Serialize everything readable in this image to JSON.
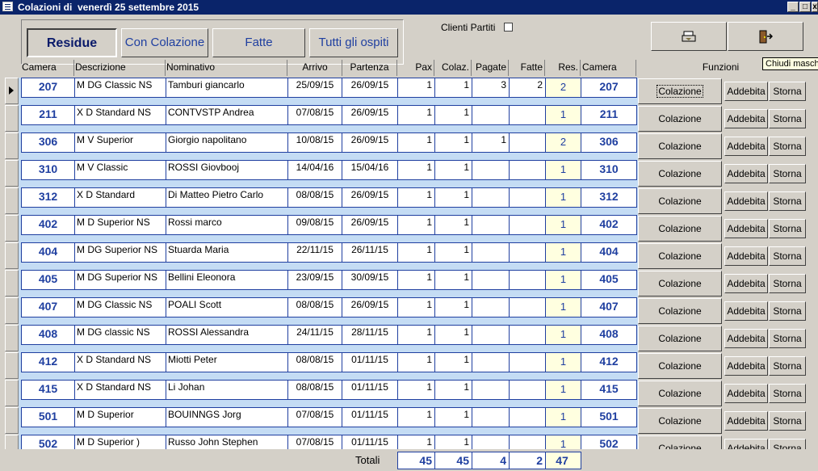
{
  "window": {
    "title": "Colazioni di  venerdì 25 settembre 2015",
    "min": "_",
    "max": "□",
    "close": "x"
  },
  "tabs": [
    {
      "label": "Residue",
      "active": true
    },
    {
      "label": "Con Colazione",
      "active": false
    },
    {
      "label": "Fatte",
      "active": false
    },
    {
      "label": "Tutti gli ospiti",
      "active": false
    }
  ],
  "filter": {
    "label": "Clienti Partiti",
    "checked": false
  },
  "toolbar": {
    "print_icon": "print-icon",
    "exit_icon": "exit-door-icon",
    "tooltip": "Chiudi maschera"
  },
  "columns": {
    "camera": "Camera",
    "descrizione": "Descrizione",
    "nominativo": "Nominativo",
    "arrivo": "Arrivo",
    "partenza": "Partenza",
    "pax": "Pax",
    "colaz": "Colaz.",
    "pagate": "Pagate",
    "fatte": "Fatte",
    "res": "Res.",
    "camera2": "Camera",
    "funzioni": "Funzioni"
  },
  "buttons": {
    "colazione": "Colazione",
    "addebita": "Addebita",
    "storna": "Storna"
  },
  "rows": [
    {
      "camera": "207",
      "descrizione": "M DG Classic NS",
      "nominativo": "Tamburi giancarlo",
      "arrivo": "25/09/15",
      "partenza": "26/09/15",
      "pax": "1",
      "colaz": "1",
      "pagate": "3",
      "fatte": "2",
      "res": "2"
    },
    {
      "camera": "211",
      "descrizione": "X D Standard NS",
      "nominativo": "CONTVSTP Andrea",
      "arrivo": "07/08/15",
      "partenza": "26/09/15",
      "pax": "1",
      "colaz": "1",
      "pagate": "",
      "fatte": "",
      "res": "1"
    },
    {
      "camera": "306",
      "descrizione": "M V Superior",
      "nominativo": "Giorgio napolitano",
      "arrivo": "10/08/15",
      "partenza": "26/09/15",
      "pax": "1",
      "colaz": "1",
      "pagate": "1",
      "fatte": "",
      "res": "2"
    },
    {
      "camera": "310",
      "descrizione": "M V Classic",
      "nominativo": "ROSSI Giovbooj",
      "arrivo": "14/04/16",
      "partenza": "15/04/16",
      "pax": "1",
      "colaz": "1",
      "pagate": "",
      "fatte": "",
      "res": "1"
    },
    {
      "camera": "312",
      "descrizione": "X D Standard",
      "nominativo": "Di Matteo Pietro Carlo",
      "arrivo": "08/08/15",
      "partenza": "26/09/15",
      "pax": "1",
      "colaz": "1",
      "pagate": "",
      "fatte": "",
      "res": "1"
    },
    {
      "camera": "402",
      "descrizione": "M D Superior NS",
      "nominativo": "Rossi marco",
      "arrivo": "09/08/15",
      "partenza": "26/09/15",
      "pax": "1",
      "colaz": "1",
      "pagate": "",
      "fatte": "",
      "res": "1"
    },
    {
      "camera": "404",
      "descrizione": "M DG Superior NS",
      "nominativo": "Stuarda Maria",
      "arrivo": "22/11/15",
      "partenza": "26/11/15",
      "pax": "1",
      "colaz": "1",
      "pagate": "",
      "fatte": "",
      "res": "1"
    },
    {
      "camera": "405",
      "descrizione": "M DG Superior NS",
      "nominativo": "Bellini Eleonora",
      "arrivo": "23/09/15",
      "partenza": "30/09/15",
      "pax": "1",
      "colaz": "1",
      "pagate": "",
      "fatte": "",
      "res": "1"
    },
    {
      "camera": "407",
      "descrizione": "M DG Classic NS",
      "nominativo": "POALI Scott",
      "arrivo": "08/08/15",
      "partenza": "26/09/15",
      "pax": "1",
      "colaz": "1",
      "pagate": "",
      "fatte": "",
      "res": "1"
    },
    {
      "camera": "408",
      "descrizione": "M DG classic NS",
      "nominativo": "ROSSI Alessandra",
      "arrivo": "24/11/15",
      "partenza": "28/11/15",
      "pax": "1",
      "colaz": "1",
      "pagate": "",
      "fatte": "",
      "res": "1"
    },
    {
      "camera": "412",
      "descrizione": "X D Standard NS",
      "nominativo": "Miotti Peter",
      "arrivo": "08/08/15",
      "partenza": "01/11/15",
      "pax": "1",
      "colaz": "1",
      "pagate": "",
      "fatte": "",
      "res": "1"
    },
    {
      "camera": "415",
      "descrizione": "X D Standard NS",
      "nominativo": "Li Johan",
      "arrivo": "08/08/15",
      "partenza": "01/11/15",
      "pax": "1",
      "colaz": "1",
      "pagate": "",
      "fatte": "",
      "res": "1"
    },
    {
      "camera": "501",
      "descrizione": "M D  Superior",
      "nominativo": "BOUINNGS Jorg",
      "arrivo": "07/08/15",
      "partenza": "01/11/15",
      "pax": "1",
      "colaz": "1",
      "pagate": "",
      "fatte": "",
      "res": "1"
    },
    {
      "camera": "502",
      "descrizione": "M D Superior )",
      "nominativo": "Russo John Stephen",
      "arrivo": "07/08/15",
      "partenza": "01/11/15",
      "pax": "1",
      "colaz": "1",
      "pagate": "",
      "fatte": "",
      "res": "1"
    }
  ],
  "totals": {
    "label": "Totali",
    "pax": "45",
    "colaz": "45",
    "pagate": "4",
    "fatte": "2",
    "res": "47"
  }
}
